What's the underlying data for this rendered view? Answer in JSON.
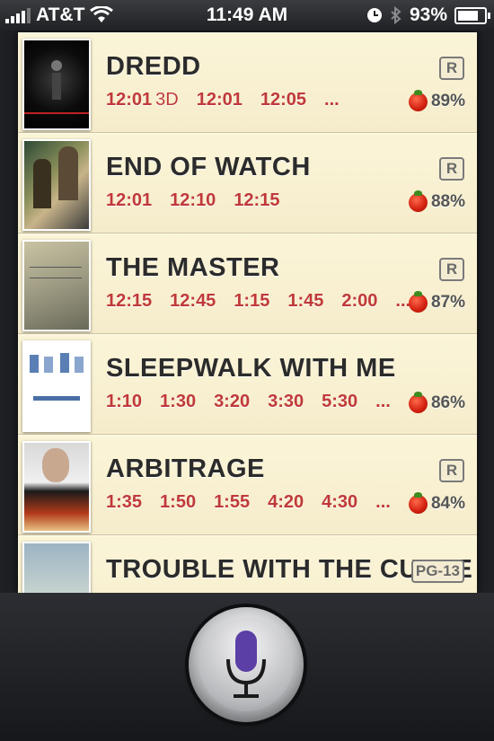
{
  "status_bar": {
    "carrier": "AT&T",
    "time": "11:49 AM",
    "battery_percent": "93%",
    "battery_level": 0.93,
    "icons": [
      "signal-bars-icon",
      "wifi-icon",
      "clock-icon",
      "bluetooth-icon",
      "battery-icon"
    ]
  },
  "movies": [
    {
      "title": "DREDD",
      "times": [
        "12:01",
        "12:01",
        "12:05",
        "..."
      ],
      "label_3d": "3D",
      "rating": "R",
      "score": "89%"
    },
    {
      "title": "END OF WATCH",
      "times": [
        "12:01",
        "12:10",
        "12:15"
      ],
      "rating": "R",
      "score": "88%"
    },
    {
      "title": "THE MASTER",
      "times": [
        "12:15",
        "12:45",
        "1:15",
        "1:45",
        "2:00",
        "..."
      ],
      "rating": "R",
      "score": "87%"
    },
    {
      "title": "SLEEPWALK WITH ME",
      "times": [
        "1:10",
        "1:30",
        "3:20",
        "3:30",
        "5:30",
        "..."
      ],
      "rating": "",
      "score": "86%"
    },
    {
      "title": "ARBITRAGE",
      "times": [
        "1:35",
        "1:50",
        "1:55",
        "4:20",
        "4:30",
        "..."
      ],
      "rating": "R",
      "score": "84%"
    },
    {
      "title": "TROUBLE WITH THE CURVE",
      "times": [],
      "rating": "PG-13",
      "score": ""
    }
  ],
  "colors": {
    "showtime": "#c0393a",
    "row_bg": "#f8f0d0",
    "mic_accent": "#5b3fa6"
  },
  "siri_button": {
    "icon": "microphone-icon"
  }
}
